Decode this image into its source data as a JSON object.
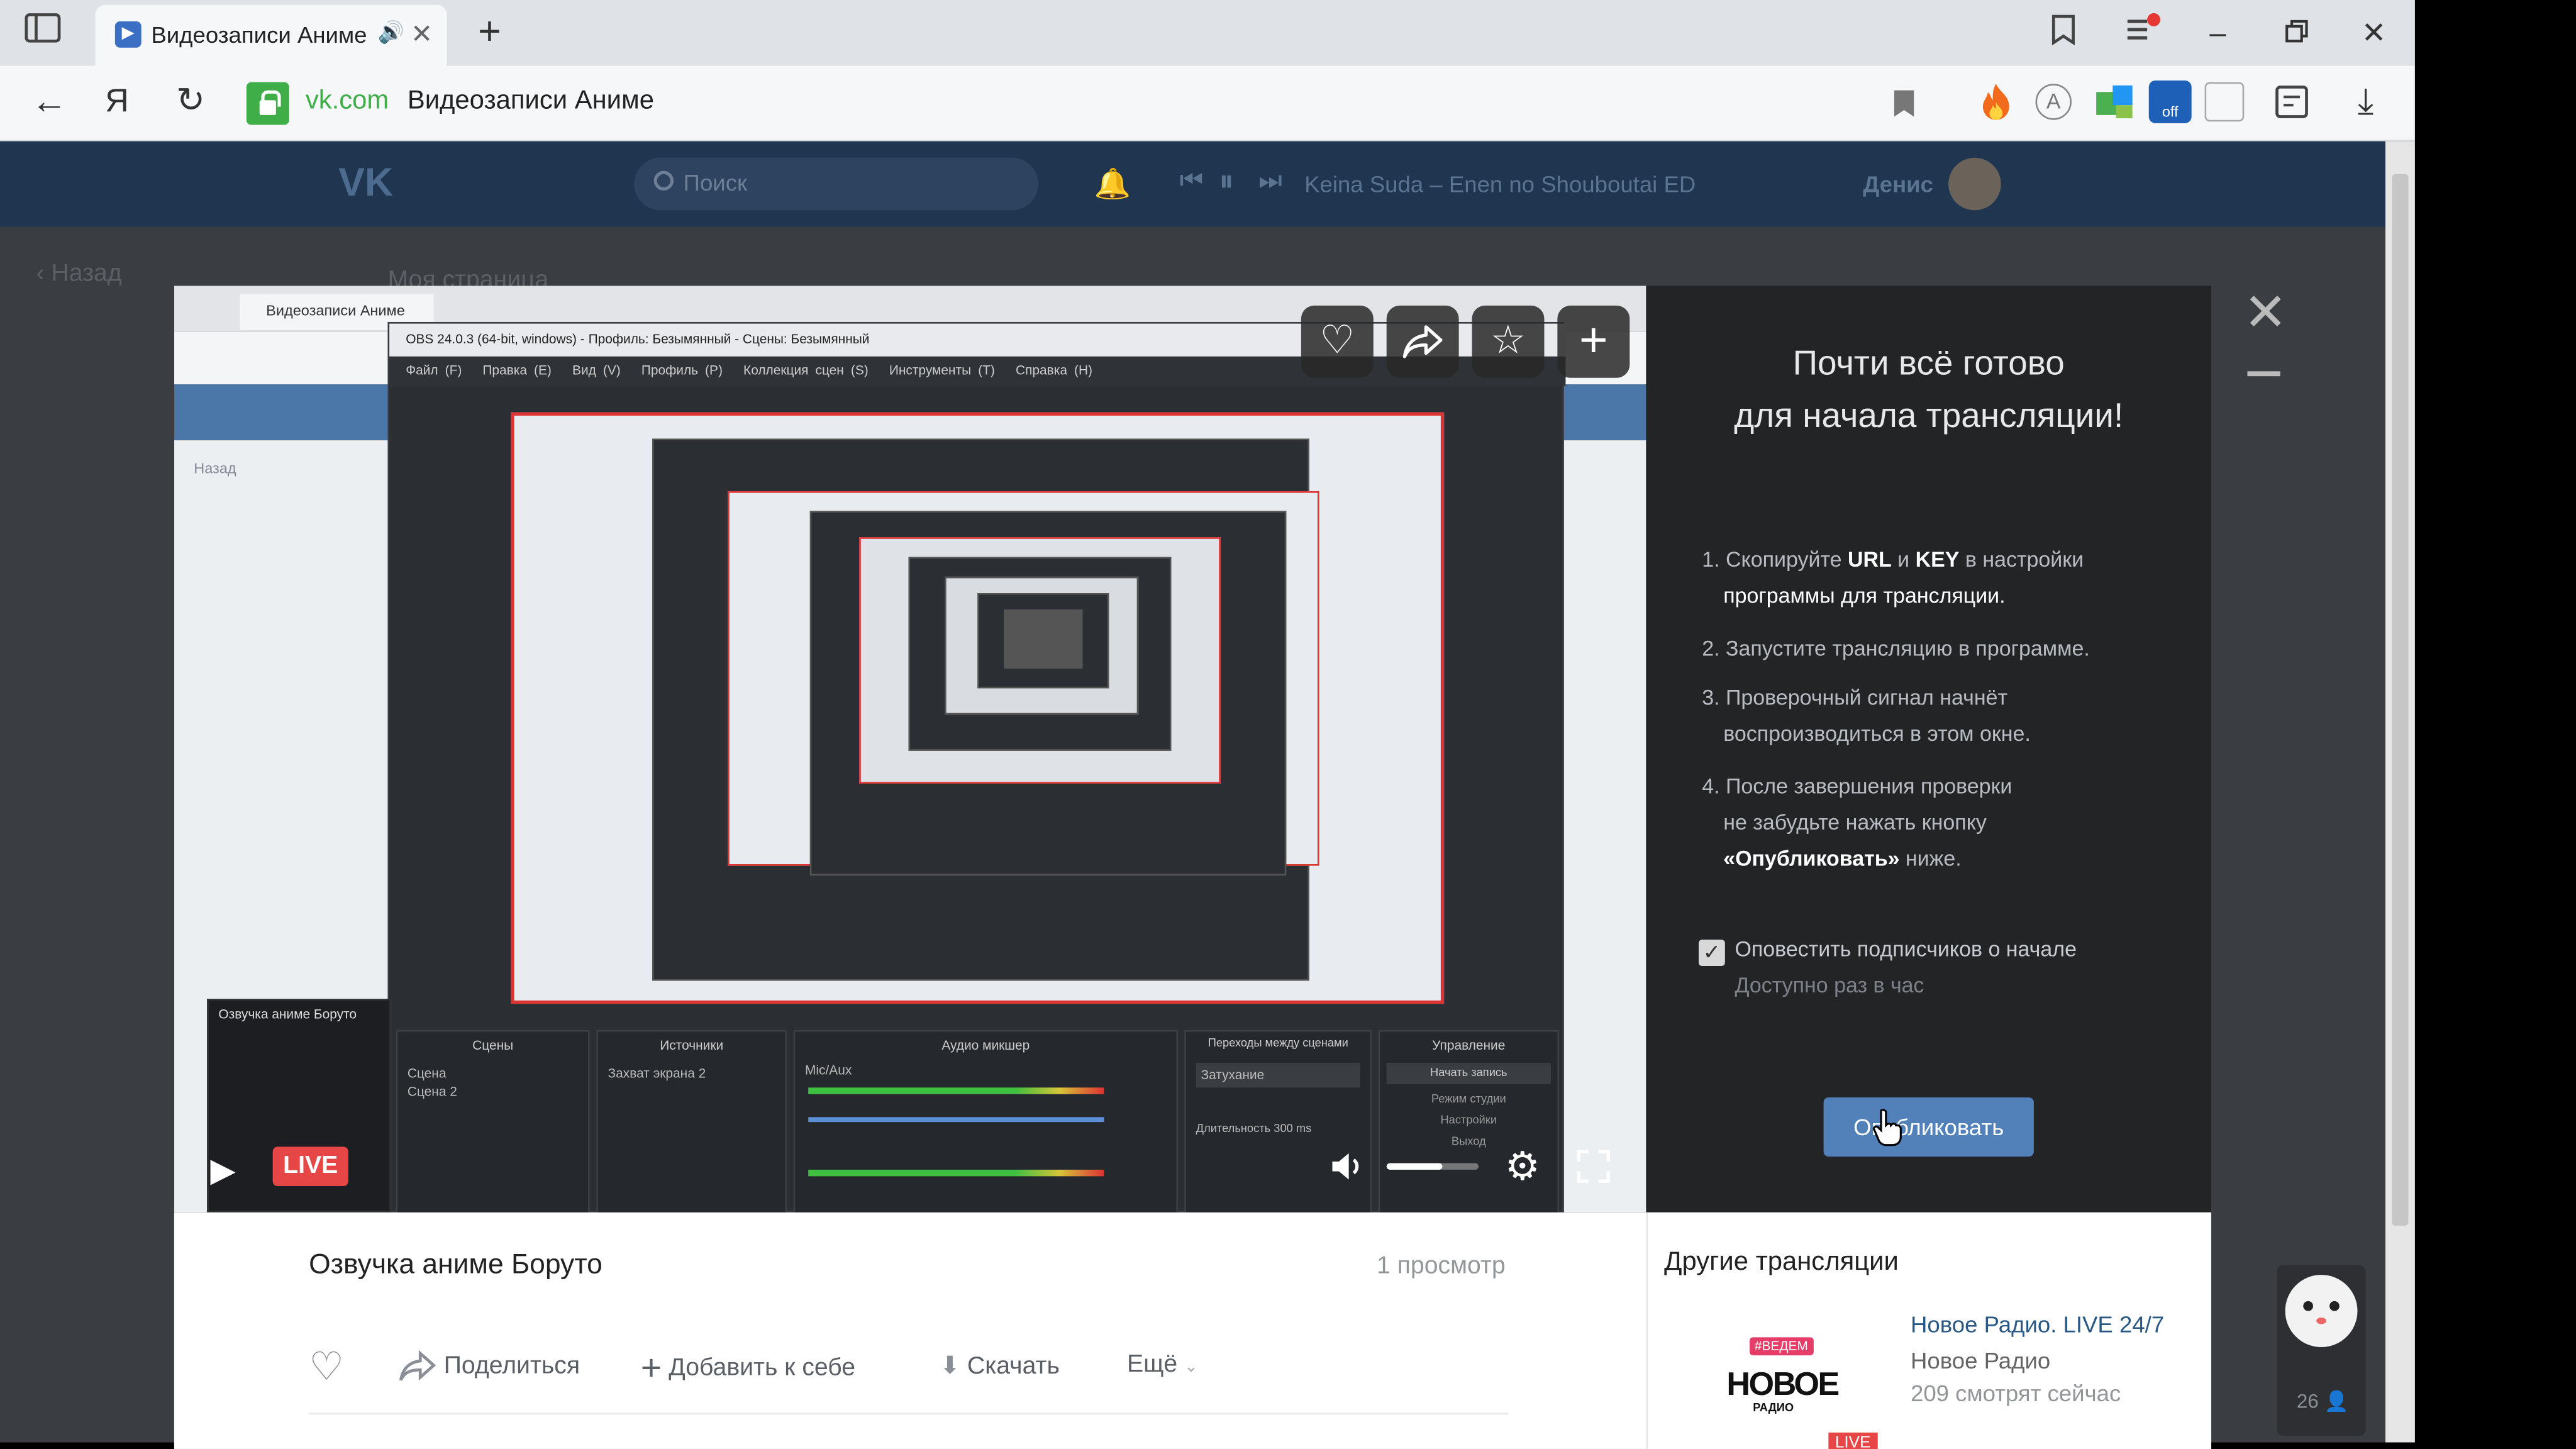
{
  "browser": {
    "tab_title": "Видеозаписи Аниме",
    "domain": "vk.com",
    "page_title": "Видеозаписи Аниме",
    "yandex_letter": "Я"
  },
  "vk": {
    "search_placeholder": "Поиск",
    "now_playing": "Keina Suda – Enen no Shouboutai ED",
    "user_name": "Денис",
    "back_label": "Назад",
    "my_page": "Моя страница"
  },
  "inner_screen": {
    "obs_title": "OBS 24.0.3 (64-bit, windows) - Профиль: Безымянный - Сцены: Безымянный",
    "obs_menu": [
      "Файл (F)",
      "Правка (E)",
      "Вид (V)",
      "Профиль (P)",
      "Коллекция сцен (S)",
      "Инструменты (T)",
      "Справка (H)"
    ],
    "panels": [
      "Сцены",
      "Источники",
      "Аудио микшер",
      "Переходы между сценами",
      "Управление"
    ],
    "scenes": [
      "Сцена",
      "Сцена 2"
    ],
    "source": "Захват экрана 2",
    "mic_label": "Mic/Aux",
    "transition": "Затухание",
    "duration_label": "Длительность",
    "duration_value": "300 ms",
    "control_buttons": [
      "Начать запись",
      "Режим студии",
      "Настройки",
      "Выход"
    ],
    "mini_title": "Озвучка аниме Боруто",
    "inner_tab": "Видеозаписи Аниме",
    "inner_back": "Назад"
  },
  "player": {
    "live_badge": "LIVE",
    "volume_percent": 60
  },
  "sidepanel": {
    "title_line1": "Почти всё готово",
    "title_line2": "для начала трансляции!",
    "step1_pre": "1. Скопируйте ",
    "step1_url": "URL",
    "step1_and": " и ",
    "step1_key": "KEY",
    "step1_post": " в настройки",
    "step1_line2": "программы для трансляции.",
    "step2": "2. Запустите трансляцию в программе.",
    "step3_line1": "3. Проверочный сигнал начнёт",
    "step3_line2": "воспроизводиться в этом окне.",
    "step4_line1": "4. После завершения проверки",
    "step4_line2": "не забудьте нажать кнопку",
    "step4_bold": "«Опубликовать»",
    "step4_tail": " ниже.",
    "notify_label": "Оповестить подписчиков о начале",
    "notify_hint": "Доступно раз в час",
    "notify_checked": true,
    "publish_label": "Опубликовать"
  },
  "info": {
    "video_title": "Озвучка аниме Боруто",
    "views": "1 просмотр",
    "share": "Поделиться",
    "add": "Добавить к себе",
    "download": "Скачать",
    "more": "Ещё",
    "other_title": "Другие трансляции",
    "other_stream_title": "Новое Радио. LIVE 24/7",
    "other_stream_author": "Новое Радио",
    "other_stream_viewers": "209 смотрят сейчас",
    "other_live_badge": "LIVE",
    "logo_top": "#ВЕДЕМ",
    "logo_main": "НОВОЕ",
    "logo_sub": "РАДИО"
  },
  "side_widget": {
    "count": "26"
  }
}
